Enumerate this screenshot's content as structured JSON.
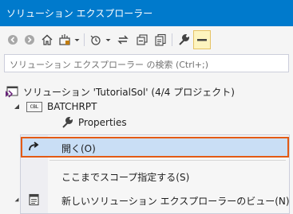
{
  "window": {
    "title": "ソリューション エクスプローラー"
  },
  "toolbar": {
    "buttons": [
      {
        "name": "back-button",
        "icon": "back-icon"
      },
      {
        "name": "forward-button",
        "icon": "forward-icon"
      },
      {
        "name": "home-button",
        "icon": "home-icon"
      },
      {
        "name": "switch-views-button",
        "icon": "switch-views-icon"
      },
      {
        "name": "pending-changes-button",
        "icon": "pending-changes-icon"
      },
      {
        "name": "sync-button",
        "icon": "sync-icon"
      },
      {
        "name": "collapse-all-button",
        "icon": "collapse-all-icon"
      },
      {
        "name": "show-all-files-button",
        "icon": "show-all-files-icon"
      },
      {
        "name": "properties-button",
        "icon": "wrench-icon"
      },
      {
        "name": "preview-button",
        "icon": "preview-icon"
      }
    ]
  },
  "search": {
    "placeholder": "ソリューション エクスプローラー の検索 (Ctrl+;)"
  },
  "tree": {
    "solution": "ソリューション 'TutorialSol' (4/4 プロジェクト)",
    "project": "BATCHRPT",
    "project_badge": "CBL",
    "properties": "Properties"
  },
  "context_menu": {
    "items": [
      {
        "label": "開く(O)",
        "icon": "open-arrow-icon",
        "selected": true
      },
      {
        "label": "ここまでスコープ指定する(S)",
        "icon": "",
        "selected": false
      },
      {
        "label": "新しいソリューション エクスプローラーのビュー(N)",
        "icon": "new-view-icon",
        "selected": false
      }
    ]
  },
  "colors": {
    "title_bar": "#007ACC",
    "selection": "#C9DEF5",
    "selection_border": "#E35A14",
    "background": "#F5F5F5"
  }
}
